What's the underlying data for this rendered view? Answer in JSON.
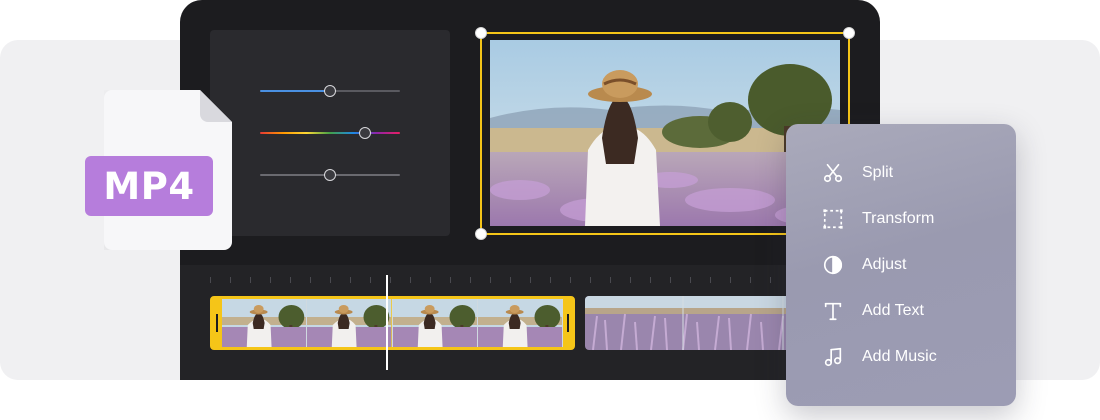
{
  "file_badge": {
    "label": "MP4",
    "icon": "mp4-file-icon",
    "color": "#b67ddc"
  },
  "adjust_panel": {
    "sliders": [
      {
        "id": "slider-1",
        "level": 0.49,
        "color": "#4a90e2"
      },
      {
        "id": "slider-2-hue",
        "level": 0.74,
        "color": "rainbow"
      },
      {
        "id": "slider-3",
        "level": 0.49,
        "color": "#6a6a70"
      }
    ]
  },
  "preview": {
    "selection_color": "#f5c518",
    "scene": "woman-in-hat-lavender-field"
  },
  "timeline": {
    "selected_clip_color": "#f5c518",
    "clip_1_frame_count": 4,
    "playhead_position": 0.29
  },
  "context_menu": {
    "items": [
      {
        "label": "Split",
        "icon": "scissors-icon"
      },
      {
        "label": "Transform",
        "icon": "transform-icon"
      },
      {
        "label": "Adjust",
        "icon": "contrast-icon"
      },
      {
        "label": "Add Text",
        "icon": "text-icon"
      },
      {
        "label": "Add Music",
        "icon": "music-note-icon"
      }
    ]
  }
}
